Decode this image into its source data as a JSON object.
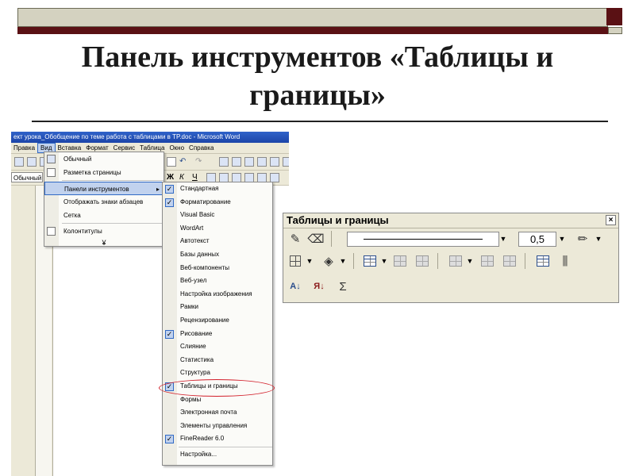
{
  "slide": {
    "title": "Панель инструментов «Таблицы и границы»"
  },
  "word": {
    "window_title": "ект урока_Обобщение по теме работа с таблицами в TP.doc - Microsoft Word",
    "menu": [
      "Правка",
      "Вид",
      "Вставка",
      "Формат",
      "Сервис",
      "Таблица",
      "Окно",
      "Справка"
    ],
    "active_menu": "Вид",
    "style_value": "Обычный (веб)"
  },
  "view_menu": {
    "items": [
      {
        "label": "Обычный",
        "icon": "normal-view-icon"
      },
      {
        "label": "Разметка страницы",
        "icon": "page-layout-icon"
      },
      {
        "label": "Панели инструментов",
        "submenu": "▸",
        "highlighted": true
      },
      {
        "label": "Отображать знаки абзацев"
      },
      {
        "label": "Сетка"
      },
      {
        "label": "Колонтитулы",
        "icon": "header-footer-icon"
      }
    ],
    "more": "¥"
  },
  "toolbars_submenu": {
    "items": [
      {
        "label": "Стандартная",
        "checked": true
      },
      {
        "label": "Форматирование",
        "checked": true
      },
      {
        "label": "Visual Basic",
        "checked": false
      },
      {
        "label": "WordArt",
        "checked": false
      },
      {
        "label": "Автотекст",
        "checked": false
      },
      {
        "label": "Базы данных",
        "checked": false
      },
      {
        "label": "Веб-компоненты",
        "checked": false
      },
      {
        "label": "Веб-узел",
        "checked": false
      },
      {
        "label": "Настройка изображения",
        "checked": false
      },
      {
        "label": "Рамки",
        "checked": false
      },
      {
        "label": "Рецензирование",
        "checked": false
      },
      {
        "label": "Рисование",
        "checked": true
      },
      {
        "label": "Слияние",
        "checked": false
      },
      {
        "label": "Статистика",
        "checked": false
      },
      {
        "label": "Структура",
        "checked": false
      },
      {
        "label": "Таблицы и границы",
        "checked": true,
        "circled": true
      },
      {
        "label": "Формы",
        "checked": false
      },
      {
        "label": "Электронная почта",
        "checked": false
      },
      {
        "label": "Элементы управления",
        "checked": false
      },
      {
        "label": "FineReader 6.0",
        "checked": true
      }
    ],
    "customize": "Настройка..."
  },
  "tables_toolbar": {
    "title": "Таблицы и границы",
    "close": "×",
    "line_weight": "0,5",
    "sort_asc_icon": "sort-ascending-icon",
    "sort_desc_icon": "sort-descending-icon",
    "autosum": "Σ"
  },
  "colors": {
    "accent_dark": "#5a1114",
    "highlight": "#c1d2ee",
    "circle": "#d21f2a"
  }
}
